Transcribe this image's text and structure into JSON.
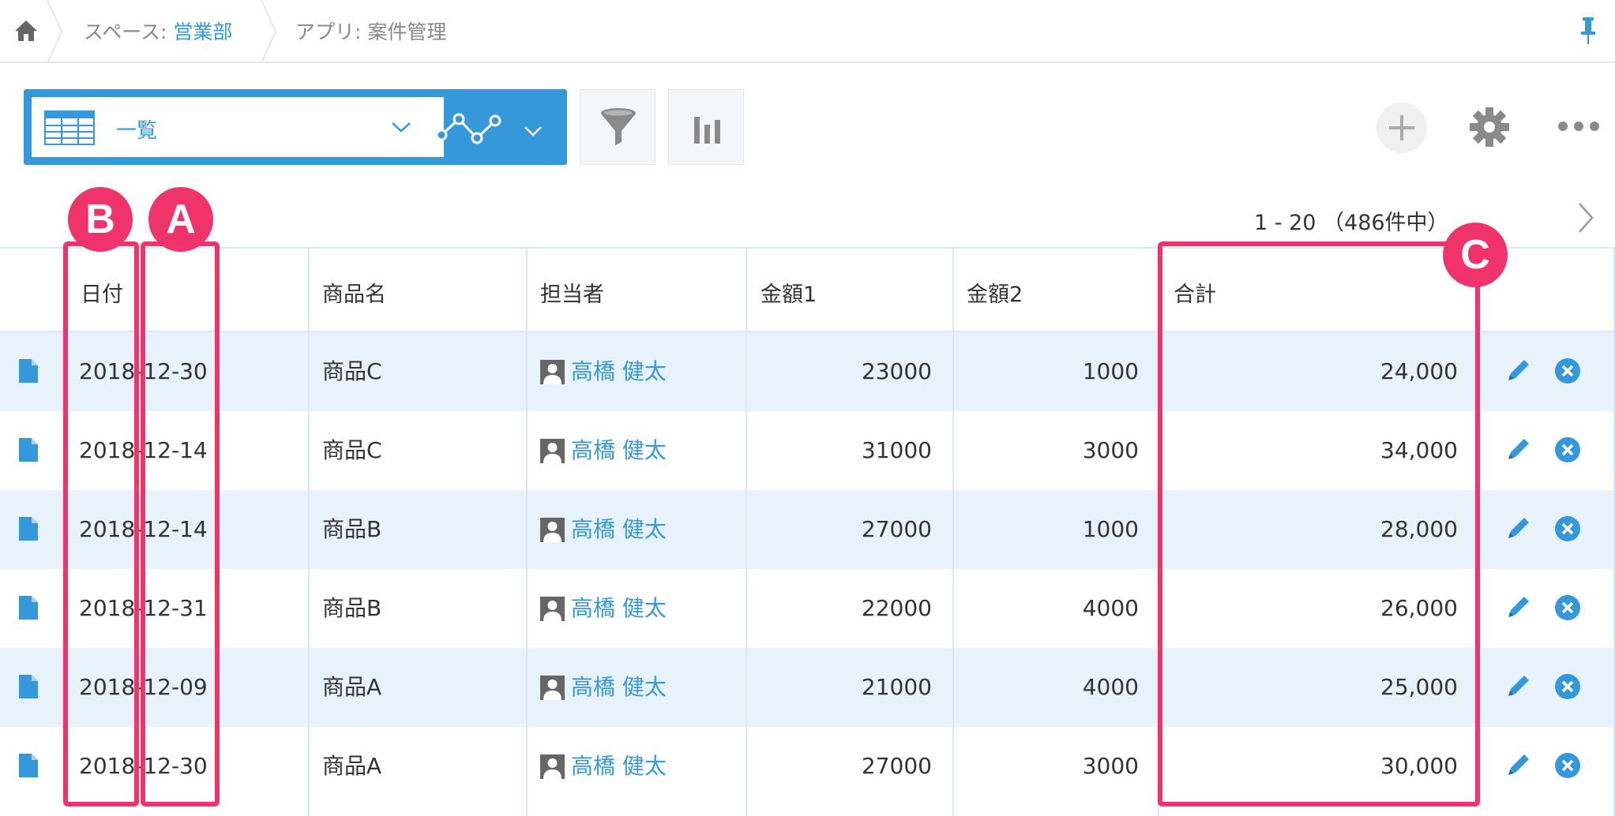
{
  "breadcrumb": {
    "space_prefix": "スペース: ",
    "space_name": "営業部",
    "app_label": "アプリ: 案件管理"
  },
  "toolbar": {
    "view_name": "一覧"
  },
  "pager": {
    "range_text": "1 - 20 （486件中）"
  },
  "table": {
    "headers": [
      "日付",
      "商品名",
      "担当者",
      "金額1",
      "金額2",
      "合計"
    ],
    "rows": [
      {
        "date": "2018-12-30",
        "product": "商品C",
        "person": "高橋 健太",
        "amount1": "23000",
        "amount2": "1000",
        "total": "24,000"
      },
      {
        "date": "2018-12-14",
        "product": "商品C",
        "person": "高橋 健太",
        "amount1": "31000",
        "amount2": "3000",
        "total": "34,000"
      },
      {
        "date": "2018-12-14",
        "product": "商品B",
        "person": "高橋 健太",
        "amount1": "27000",
        "amount2": "1000",
        "total": "28,000"
      },
      {
        "date": "2018-12-31",
        "product": "商品B",
        "person": "高橋 健太",
        "amount1": "22000",
        "amount2": "4000",
        "total": "26,000"
      },
      {
        "date": "2018-12-09",
        "product": "商品A",
        "person": "高橋 健太",
        "amount1": "21000",
        "amount2": "4000",
        "total": "25,000"
      },
      {
        "date": "2018-12-30",
        "product": "商品A",
        "person": "高橋 健太",
        "amount1": "27000",
        "amount2": "3000",
        "total": "30,000"
      }
    ]
  },
  "annotations": {
    "badge_b": "B",
    "badge_a": "A",
    "badge_c": "C"
  },
  "colors": {
    "accent": "#3498db",
    "highlight": "#f0336a",
    "row_alt": "#e8f2fb"
  },
  "icons": [
    "home-icon",
    "pin-icon",
    "table-view-icon",
    "graph-icon",
    "filter-icon",
    "chart-icon",
    "plus-icon",
    "gear-icon",
    "more-icon",
    "next-page-icon",
    "record-detail-icon",
    "user-avatar-icon",
    "edit-icon",
    "delete-icon"
  ]
}
